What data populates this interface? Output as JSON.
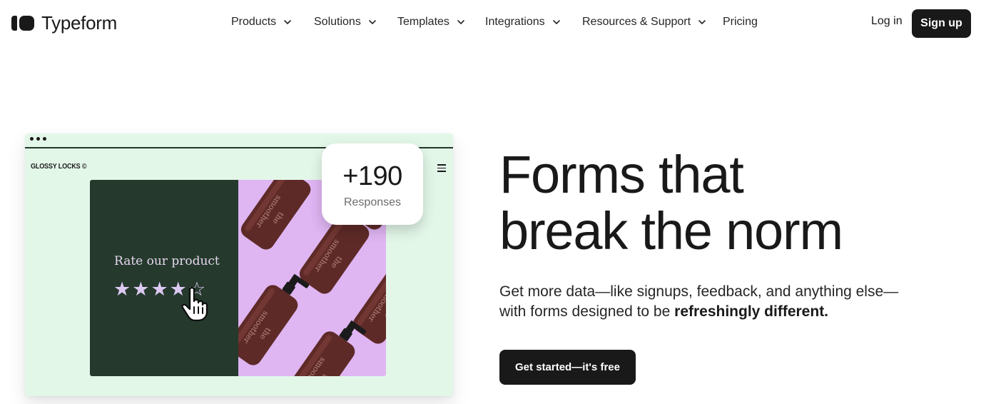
{
  "header": {
    "logo_text": "Typeform",
    "nav": [
      {
        "label": "Products",
        "has_dropdown": true
      },
      {
        "label": "Solutions",
        "has_dropdown": true
      },
      {
        "label": "Templates",
        "has_dropdown": true
      },
      {
        "label": "Integrations",
        "has_dropdown": true
      },
      {
        "label": "Resources & Support",
        "has_dropdown": true
      },
      {
        "label": "Pricing",
        "has_dropdown": false
      }
    ],
    "login_label": "Log in",
    "signup_label": "Sign up"
  },
  "illustration": {
    "brand": "GLOSSY LOCKS ©",
    "rate_prompt": "Rate our product",
    "rating": 4,
    "rating_max": 5,
    "star_full": "★",
    "star_empty": "☆",
    "responses_count": "+190",
    "responses_label": "Responses",
    "bottle_label": "the smoother"
  },
  "hero": {
    "headline_line1": "Forms that",
    "headline_line2": "break the norm",
    "subtext_start": "Get more data—like signups, feedback, and anything else—with forms designed to be ",
    "subtext_bold": "refreshingly different.",
    "cta_label": "Get started—it's free"
  },
  "colors": {
    "ink": "#191919",
    "mint": "#e3f7e9",
    "forest": "#253a2d",
    "lavender": "#dfb5f2",
    "bottle": "#5e2a27"
  }
}
